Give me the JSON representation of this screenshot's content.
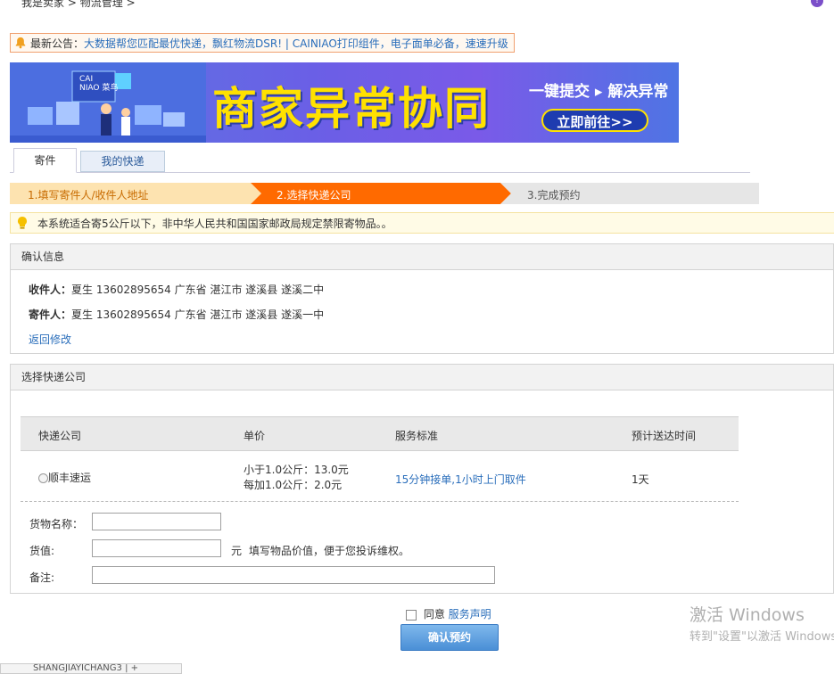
{
  "breadcrumb": {
    "home": "我是卖家",
    "sep": ">",
    "current": "物流管理",
    "sep2": ">"
  },
  "help": {
    "text": "重"
  },
  "notice": {
    "label": "最新公告：",
    "text": "大数据帮您匹配最优快递，飘红物流DSR! | CAINIAO打印组件，电子面单必备，速速升级"
  },
  "banner": {
    "logo_top": "CAI",
    "logo_bottom": "NIAO 菜鸟",
    "headline": "商家异常协同",
    "sub": "一键提交 ▸ 解决异常",
    "cta": "立即前往>>"
  },
  "tabs": {
    "send": "寄件",
    "my_express": "我的快递"
  },
  "steps": {
    "step1": "1.填写寄件人/收件人地址",
    "step2": "2.选择快递公司",
    "step3": "3.完成预约",
    "colors": {
      "done": "#fde3b0",
      "active": "#ff6a00",
      "todo": "#e6e6e6"
    }
  },
  "tip": {
    "text": "本系统适合寄5公斤以下，非中华人民共和国国家邮政局规定禁限寄物品。。"
  },
  "confirm": {
    "title": "确认信息",
    "receiver_label": "收件人：",
    "receiver": "夏生 13602895654 广东省 湛江市 遂溪县 遂溪二中",
    "sender_label": "寄件人：",
    "sender": "夏生 13602895654 广东省 湛江市 遂溪县 遂溪一中",
    "back": "返回修改"
  },
  "company": {
    "title": "选择快递公司",
    "columns": [
      "快递公司",
      "单价",
      "服务标准",
      "预计送达时间"
    ],
    "rows": [
      {
        "name": "顺丰速运",
        "price_line1": "小于1.0公斤：13.0元",
        "price_line2": "每加1.0公斤：2.0元",
        "service": "15分钟接单,1小时上门取件",
        "eta": "1天"
      }
    ]
  },
  "form": {
    "goods_label": "货物名称：",
    "goods_value": "",
    "value_label": "货值:",
    "value_value": "",
    "value_unit": "元",
    "value_hint": "填写物品价值，便于您投诉维权。",
    "remark_label": "备注:",
    "remark_value": ""
  },
  "agree": {
    "label": "同意",
    "link": "服务声明"
  },
  "submit": "确认预约",
  "watermark": {
    "line1": "激活 Windows",
    "line2": "转到\"设置\"以激活 Windows。"
  },
  "bottom_tab": "SHANGJIAYICHANG3 | +"
}
